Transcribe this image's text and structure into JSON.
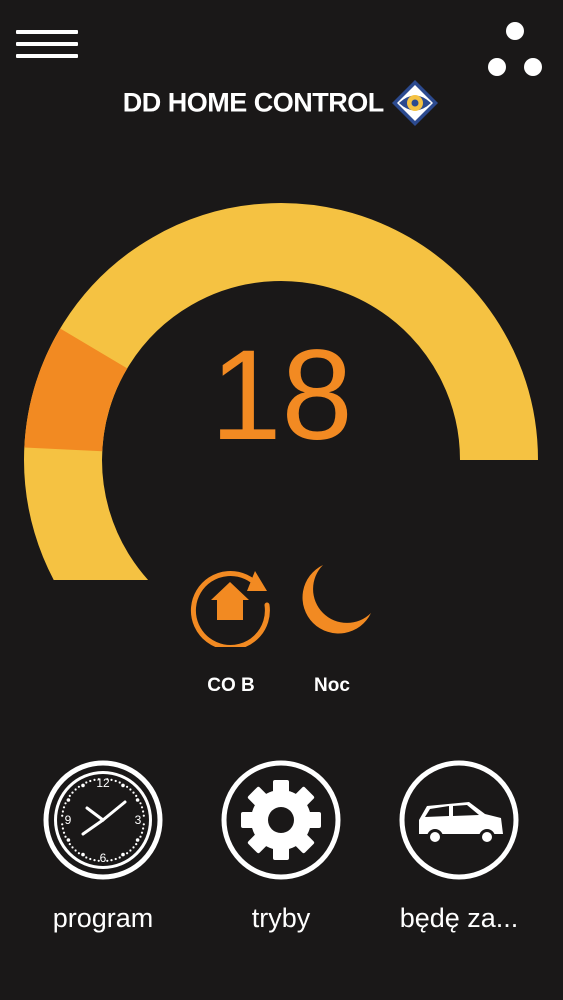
{
  "header": {
    "brand_title": "DD HOME CONTROL",
    "menu_icon": "hamburger-menu-icon",
    "more_icon": "three-dots-icon"
  },
  "thermostat": {
    "temperature": "18",
    "arc_fill_fraction": 1.0,
    "current_marker_fraction": 0.32,
    "colors": {
      "arc": "#f5c242",
      "marker": "#f28a22",
      "temperature": "#f28a22"
    }
  },
  "status": {
    "mode_label": "CO B",
    "mode_icon": "home-cycle-icon",
    "period_label": "Noc",
    "period_icon": "moon-icon"
  },
  "actions": [
    {
      "label": "program",
      "icon": "clock-icon"
    },
    {
      "label": "tryby",
      "icon": "gear-icon"
    },
    {
      "label": "będę za...",
      "icon": "car-icon"
    }
  ]
}
